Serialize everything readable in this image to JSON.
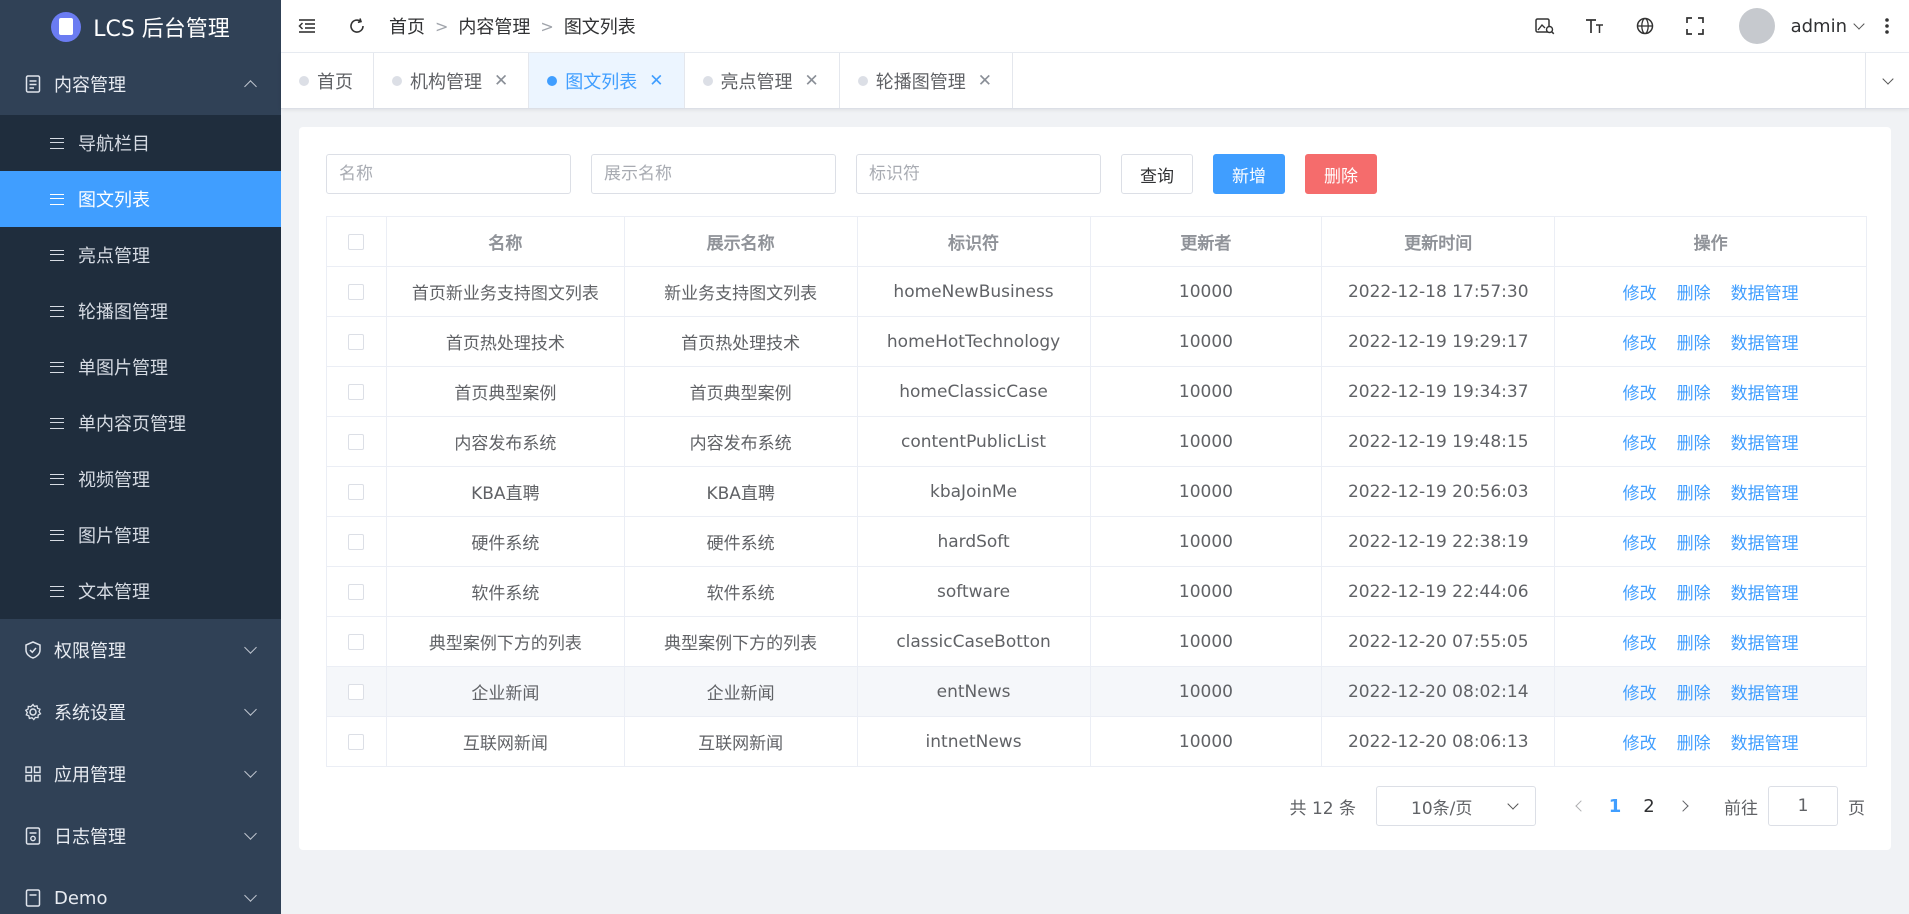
{
  "app": {
    "title": "LCS 后台管理"
  },
  "sidebar": {
    "groups": [
      {
        "label": "内容管理",
        "icon": "document-icon",
        "expanded": true
      },
      {
        "label": "权限管理",
        "icon": "shield-icon"
      },
      {
        "label": "系统设置",
        "icon": "gear-icon"
      },
      {
        "label": "应用管理",
        "icon": "grid-icon"
      },
      {
        "label": "日志管理",
        "icon": "log-icon"
      },
      {
        "label": "Demo",
        "icon": "demo-icon"
      }
    ],
    "content_items": [
      "导航栏目",
      "图文列表",
      "亮点管理",
      "轮播图管理",
      "单图片管理",
      "单内容页管理",
      "视频管理",
      "图片管理",
      "文本管理"
    ],
    "active_item": "图文列表"
  },
  "header": {
    "breadcrumb": [
      "首页",
      "内容管理",
      "图文列表"
    ],
    "username": "admin"
  },
  "tabs": [
    {
      "label": "首页",
      "closable": false,
      "active": false
    },
    {
      "label": "机构管理",
      "closable": true,
      "active": false
    },
    {
      "label": "图文列表",
      "closable": true,
      "active": true
    },
    {
      "label": "亮点管理",
      "closable": true,
      "active": false
    },
    {
      "label": "轮播图管理",
      "closable": true,
      "active": false
    }
  ],
  "filters": {
    "name_placeholder": "名称",
    "display_name_placeholder": "展示名称",
    "identifier_placeholder": "标识符",
    "query_label": "查询",
    "add_label": "新增",
    "delete_label": "删除"
  },
  "table": {
    "headers": [
      "名称",
      "展示名称",
      "标识符",
      "更新者",
      "更新时间",
      "操作"
    ],
    "actions": [
      "修改",
      "删除",
      "数据管理"
    ],
    "rows": [
      [
        "首页新业务支持图文列表",
        "新业务支持图文列表",
        "homeNewBusiness",
        "10000",
        "2022-12-18 17:57:30"
      ],
      [
        "首页热处理技术",
        "首页热处理技术",
        "homeHotTechnology",
        "10000",
        "2022-12-19 19:29:17"
      ],
      [
        "首页典型案例",
        "首页典型案例",
        "homeClassicCase",
        "10000",
        "2022-12-19 19:34:37"
      ],
      [
        "内容发布系统",
        "内容发布系统",
        "contentPublicList",
        "10000",
        "2022-12-19 19:48:15"
      ],
      [
        "KBA直聘",
        "KBA直聘",
        "kbaJoinMe",
        "10000",
        "2022-12-19 20:56:03"
      ],
      [
        "硬件系统",
        "硬件系统",
        "hardSoft",
        "10000",
        "2022-12-19 22:38:19"
      ],
      [
        "软件系统",
        "软件系统",
        "software",
        "10000",
        "2022-12-19 22:44:06"
      ],
      [
        "典型案例下方的列表",
        "典型案例下方的列表",
        "classicCaseBotton",
        "10000",
        "2022-12-20 07:55:05"
      ],
      [
        "企业新闻",
        "企业新闻",
        "entNews",
        "10000",
        "2022-12-20 08:02:14"
      ],
      [
        "互联网新闻",
        "互联网新闻",
        "intnetNews",
        "10000",
        "2022-12-20 08:06:13"
      ]
    ],
    "hover_row": 8
  },
  "pagination": {
    "total_text": "共 12 条",
    "page_size": "10条/页",
    "pages": [
      "1",
      "2"
    ],
    "current_page": "1",
    "goto_prefix": "前往",
    "goto_value": "1",
    "goto_suffix": "页"
  },
  "colors": {
    "sidebar": "#304156",
    "submenu": "#1f2d3d",
    "accent": "#409eff",
    "danger": "#f56c6c"
  }
}
